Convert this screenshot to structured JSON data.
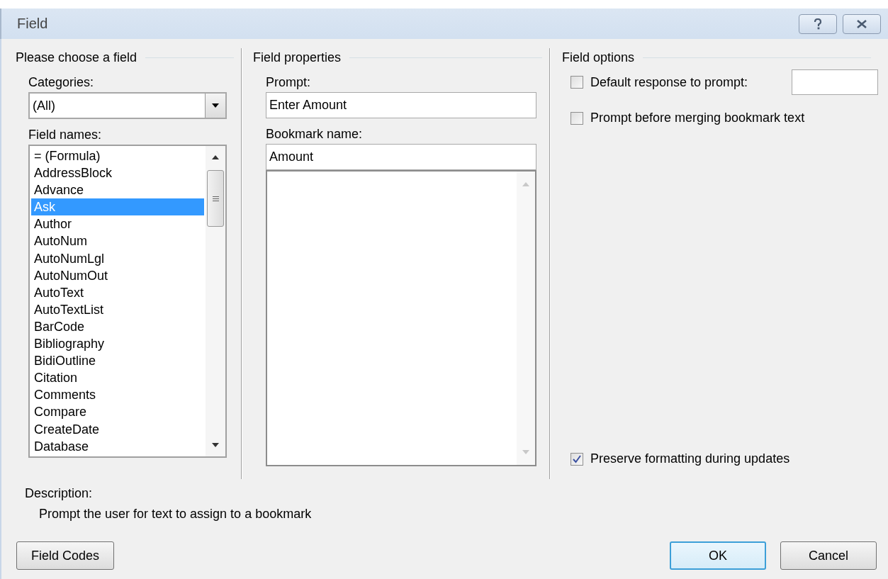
{
  "window": {
    "title": "Field"
  },
  "choose": {
    "heading": "Please choose a field",
    "categories_label": "Categories:",
    "categories_value": "(All)",
    "field_names_label": "Field names:",
    "field_names": [
      {
        "label": "= (Formula)",
        "selected": false
      },
      {
        "label": "AddressBlock",
        "selected": false
      },
      {
        "label": "Advance",
        "selected": false
      },
      {
        "label": "Ask",
        "selected": true
      },
      {
        "label": "Author",
        "selected": false
      },
      {
        "label": "AutoNum",
        "selected": false
      },
      {
        "label": "AutoNumLgl",
        "selected": false
      },
      {
        "label": "AutoNumOut",
        "selected": false
      },
      {
        "label": "AutoText",
        "selected": false
      },
      {
        "label": "AutoTextList",
        "selected": false
      },
      {
        "label": "BarCode",
        "selected": false
      },
      {
        "label": "Bibliography",
        "selected": false
      },
      {
        "label": "BidiOutline",
        "selected": false
      },
      {
        "label": "Citation",
        "selected": false
      },
      {
        "label": "Comments",
        "selected": false
      },
      {
        "label": "Compare",
        "selected": false
      },
      {
        "label": "CreateDate",
        "selected": false
      },
      {
        "label": "Database",
        "selected": false
      }
    ]
  },
  "properties": {
    "heading": "Field properties",
    "prompt_label": "Prompt:",
    "prompt_value": "Enter Amount",
    "bookmark_label": "Bookmark name:",
    "bookmark_value": "Amount"
  },
  "options": {
    "heading": "Field options",
    "checkboxes": [
      {
        "label": "Default response to prompt:",
        "checked": false,
        "kind": "with-field"
      },
      {
        "label": "Prompt before merging bookmark text",
        "checked": false,
        "kind": "plain"
      },
      {
        "label": "Preserve formatting during updates",
        "checked": true,
        "kind": "bottom"
      }
    ]
  },
  "description": {
    "label": "Description:",
    "text": "Prompt the user for text to assign to a bookmark"
  },
  "buttons": [
    {
      "label": "Field Codes",
      "kind": "left",
      "default": false
    },
    {
      "label": "OK",
      "kind": "right",
      "default": true
    },
    {
      "label": "Cancel",
      "kind": "right",
      "default": false
    }
  ]
}
